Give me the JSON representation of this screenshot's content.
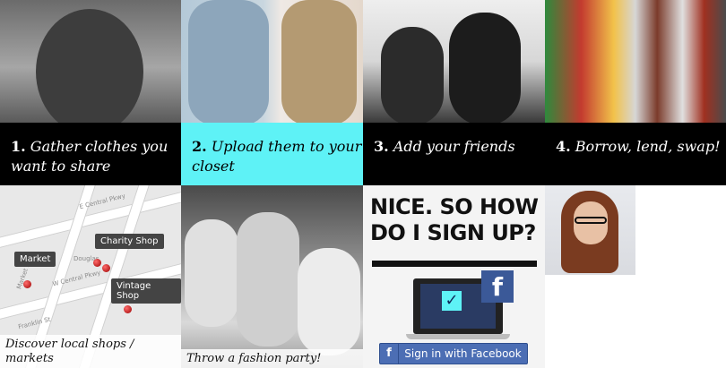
{
  "steps": [
    {
      "num": "1.",
      "text": "Gather clothes you want to share"
    },
    {
      "num": "2.",
      "text": "Upload them to your closet"
    },
    {
      "num": "3.",
      "text": "Add your friends"
    },
    {
      "num": "4.",
      "text": "Borrow, lend, swap!"
    }
  ],
  "map": {
    "tags": [
      "Market",
      "Charity Shop",
      "Vintage Shop"
    ],
    "streets": [
      "E Central Pkwy",
      "W Central Pkwy",
      "Douglas",
      "Franklin St",
      "Market St"
    ],
    "caption": "Discover local shops / markets"
  },
  "party": {
    "caption": "Throw a fashion party!"
  },
  "signup": {
    "headline": "NICE. SO HOW DO I SIGN UP?",
    "facebook_letter": "f",
    "check": "✓",
    "button_label": "Sign in with Facebook"
  },
  "colors": {
    "accent_cyan": "#5ef2f6",
    "tile_black": "#000000",
    "facebook_blue": "#3b5998"
  }
}
